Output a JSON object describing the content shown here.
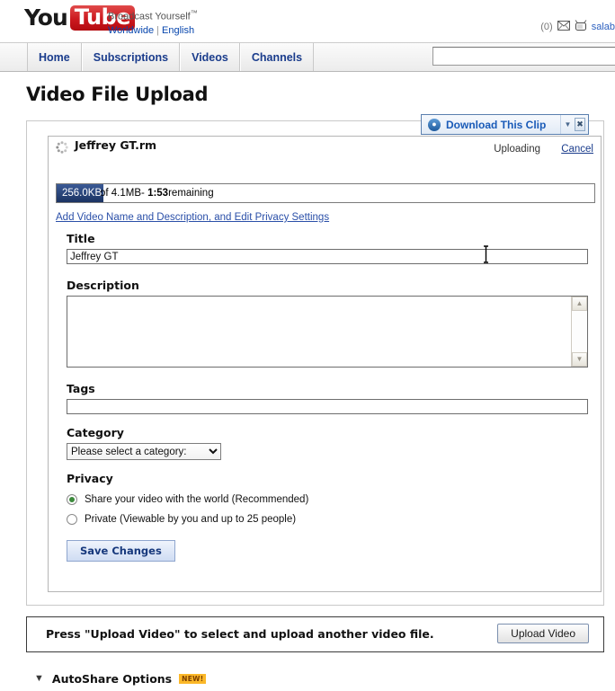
{
  "masthead": {
    "logo_you": "You",
    "logo_tube": "Tube",
    "tagline": "Broadcast Yourself",
    "tagline_tm": "™",
    "region_link": "Worldwide",
    "language_link": "English",
    "message_count": "(0)",
    "mail_icon": "envelope-icon",
    "tv_icon": "tv-icon",
    "username": "salab"
  },
  "nav": {
    "tabs": [
      {
        "label": "Home"
      },
      {
        "label": "Subscriptions"
      },
      {
        "label": "Videos"
      },
      {
        "label": "Channels"
      }
    ],
    "search_value": "",
    "search_placeholder": ""
  },
  "page": {
    "title": "Video File Upload"
  },
  "download_popup": {
    "icon": "download-clip-icon",
    "label": "Download This Clip",
    "dropdown_icon": "chevron-down-icon",
    "close_icon": "close-icon"
  },
  "upload": {
    "spinner_icon": "loading-spinner-icon",
    "file_name": "Jeffrey GT.rm",
    "status": "Uploading",
    "cancel_label": "Cancel",
    "progress": {
      "uploaded": "256.0KB",
      "rest_prefix": "of 4.1MB- ",
      "time_remaining": "1:53",
      "rest_suffix": "remaining",
      "percent": 6,
      "fill_color": "#1f3a6e"
    },
    "edit_link": "Add Video Name and Description, and Edit Privacy Settings"
  },
  "form": {
    "title_label": "Title",
    "title_value": "Jeffrey GT",
    "description_label": "Description",
    "description_value": "",
    "tags_label": "Tags",
    "tags_value": "",
    "category_label": "Category",
    "category_selected": "Please select a category:",
    "category_options": [
      "Please select a category:"
    ],
    "privacy_label": "Privacy",
    "privacy_options": [
      {
        "label": "Share your video with the world (Recommended)",
        "selected": true
      },
      {
        "label": "Private (Viewable by you and up to 25 people)",
        "selected": false
      }
    ],
    "save_label": "Save Changes"
  },
  "another_upload": {
    "message": "Press \"Upload Video\" to select and upload another video file.",
    "button_label": "Upload Video"
  },
  "autoshare": {
    "caret_icon": "triangle-down-icon",
    "label": "AutoShare Options",
    "badge": "NEW!",
    "badge_color": "#fbb829"
  }
}
